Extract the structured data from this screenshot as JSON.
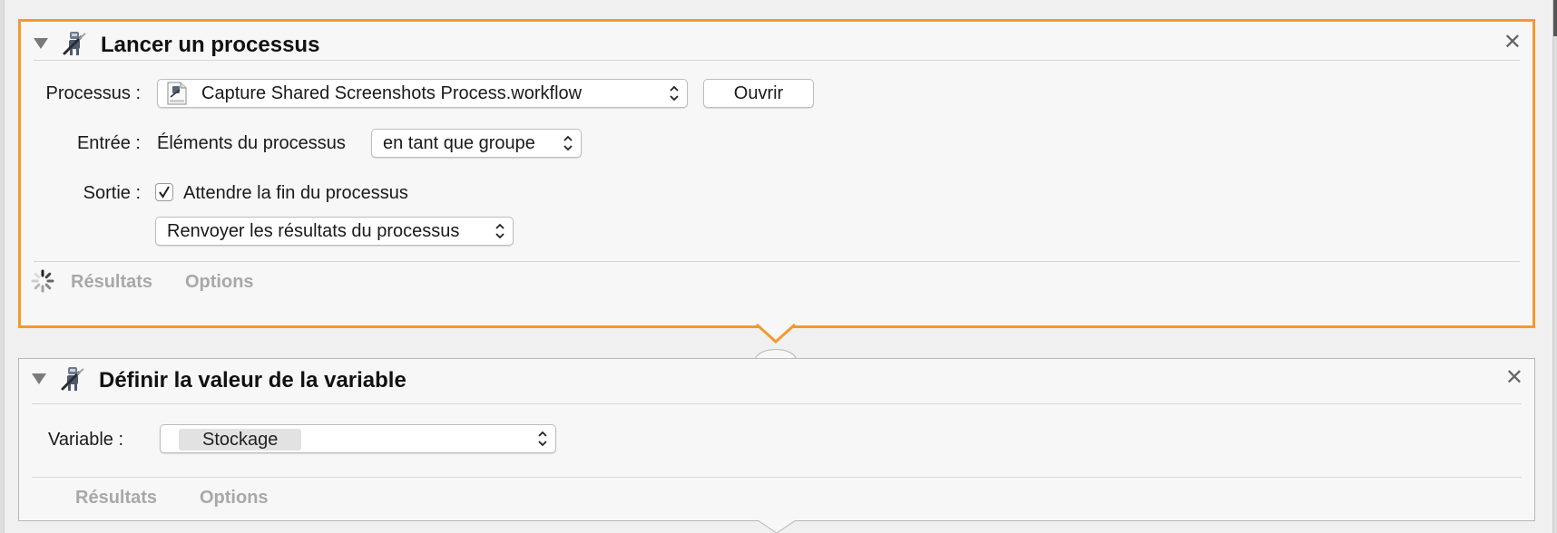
{
  "action1": {
    "title": "Lancer un processus",
    "process_label": "Processus :",
    "process_value": "Capture Shared Screenshots Process.workflow",
    "open_button": "Ouvrir",
    "input_label": "Entrée :",
    "input_text": "Éléments du processus",
    "input_mode": "en tant que groupe",
    "output_label": "Sortie :",
    "wait_label": "Attendre la fin du processus",
    "wait_checked": true,
    "return_mode": "Renvoyer les résultats du processus",
    "tabs": [
      "Résultats",
      "Options"
    ]
  },
  "action2": {
    "title": "Définir la valeur de la variable",
    "variable_label": "Variable :",
    "variable_value": "Stockage",
    "tabs": [
      "Résultats",
      "Options"
    ]
  },
  "colors": {
    "selected_border": "#f39a2b",
    "tab_text": "#a8a8a8"
  },
  "icons": [
    "disclosure-triangle-icon",
    "automator-robot-icon",
    "close-icon",
    "workflow-file-icon",
    "popup-chevrons-icon",
    "checkmark-icon",
    "spinner-icon"
  ]
}
